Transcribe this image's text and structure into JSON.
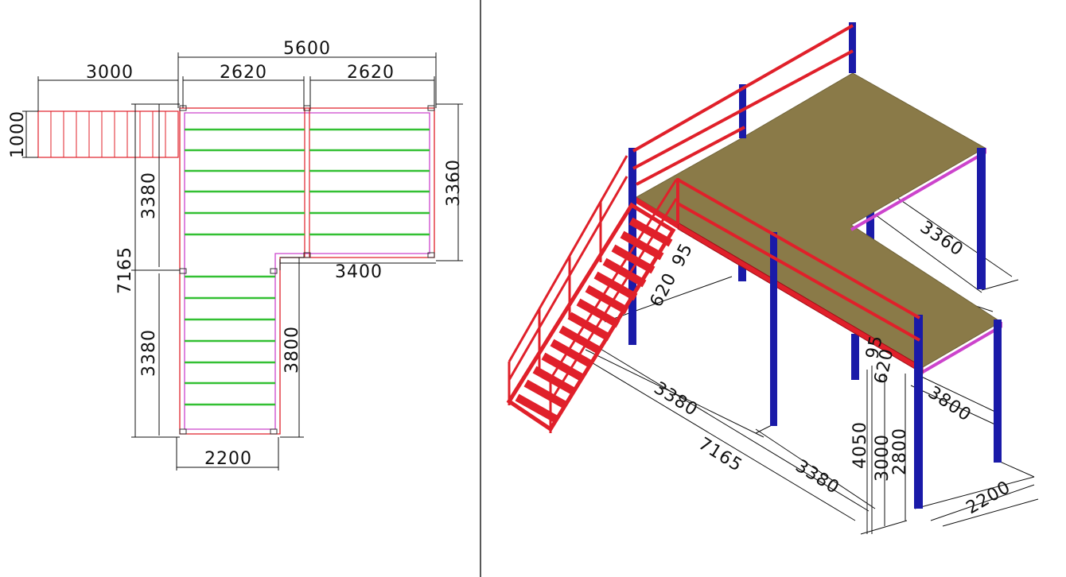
{
  "colors": {
    "frame_red": "#e0202a",
    "column_blue": "#1a1aa8",
    "deck_olive": "#8a7a48",
    "edge_magenta": "#cc44cc",
    "joist_green": "#33c033",
    "dimension_black": "#111111"
  },
  "plan_view": {
    "dimensions": {
      "overall_width": "5600",
      "stair_length": "3000",
      "bay_1_width": "2620",
      "bay_2_width": "2620",
      "stair_width": "1000",
      "upper_depth": "3360",
      "left_upper": "3380",
      "left_total": "7165",
      "left_lower": "3380",
      "notch_width": "3400",
      "lower_depth": "3800",
      "lower_width": "2200"
    }
  },
  "iso_view": {
    "dimensions": {
      "right_depth": "3360",
      "top_gap": "95",
      "stair_offset": "620",
      "left_segment": "3380",
      "total_length": "7165",
      "bottom_segment": "3380",
      "small_left": "95",
      "small_right": "620",
      "end_depth": "3800",
      "end_width": "2200",
      "height_total": "4050",
      "height_rail": "3000",
      "height_deck": "2800"
    }
  }
}
